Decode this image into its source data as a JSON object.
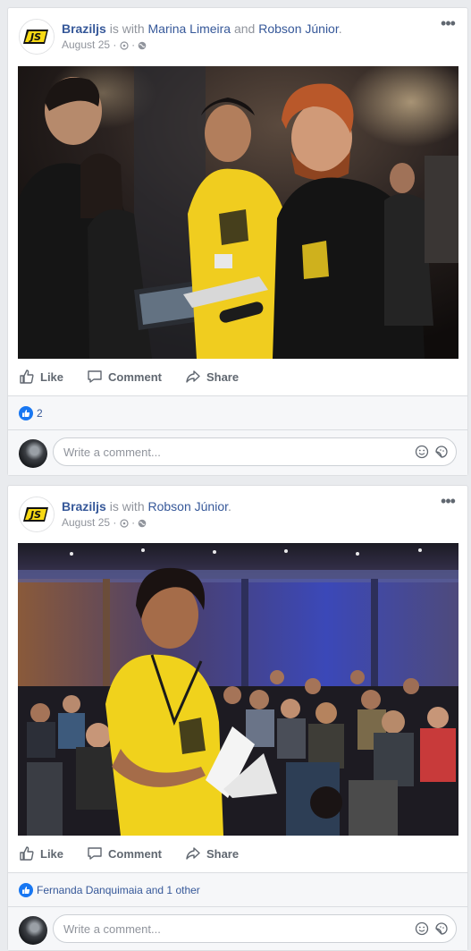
{
  "posts": [
    {
      "author": "Braziljs",
      "with_text": " is with ",
      "tagged1": "Marina Limeira",
      "and_text": " and ",
      "tagged2": "Robson Júnior",
      "end_punct": ".",
      "date": "August 25",
      "actions": {
        "like": "Like",
        "comment": "Comment",
        "share": "Share"
      },
      "reactions": "2",
      "comment_placeholder": "Write a comment..."
    },
    {
      "author": "Braziljs",
      "with_text": " is with ",
      "tagged1": "Robson Júnior",
      "end_punct": ".",
      "date": "August 25",
      "actions": {
        "like": "Like",
        "comment": "Comment",
        "share": "Share"
      },
      "reactions": "Fernanda Danquimaia and 1 other",
      "comment_placeholder": "Write a comment..."
    }
  ],
  "logo_text": "JS",
  "colors": {
    "brand_yellow": "#f7d914",
    "link_blue": "#365899",
    "like_blue": "#1877f2"
  }
}
